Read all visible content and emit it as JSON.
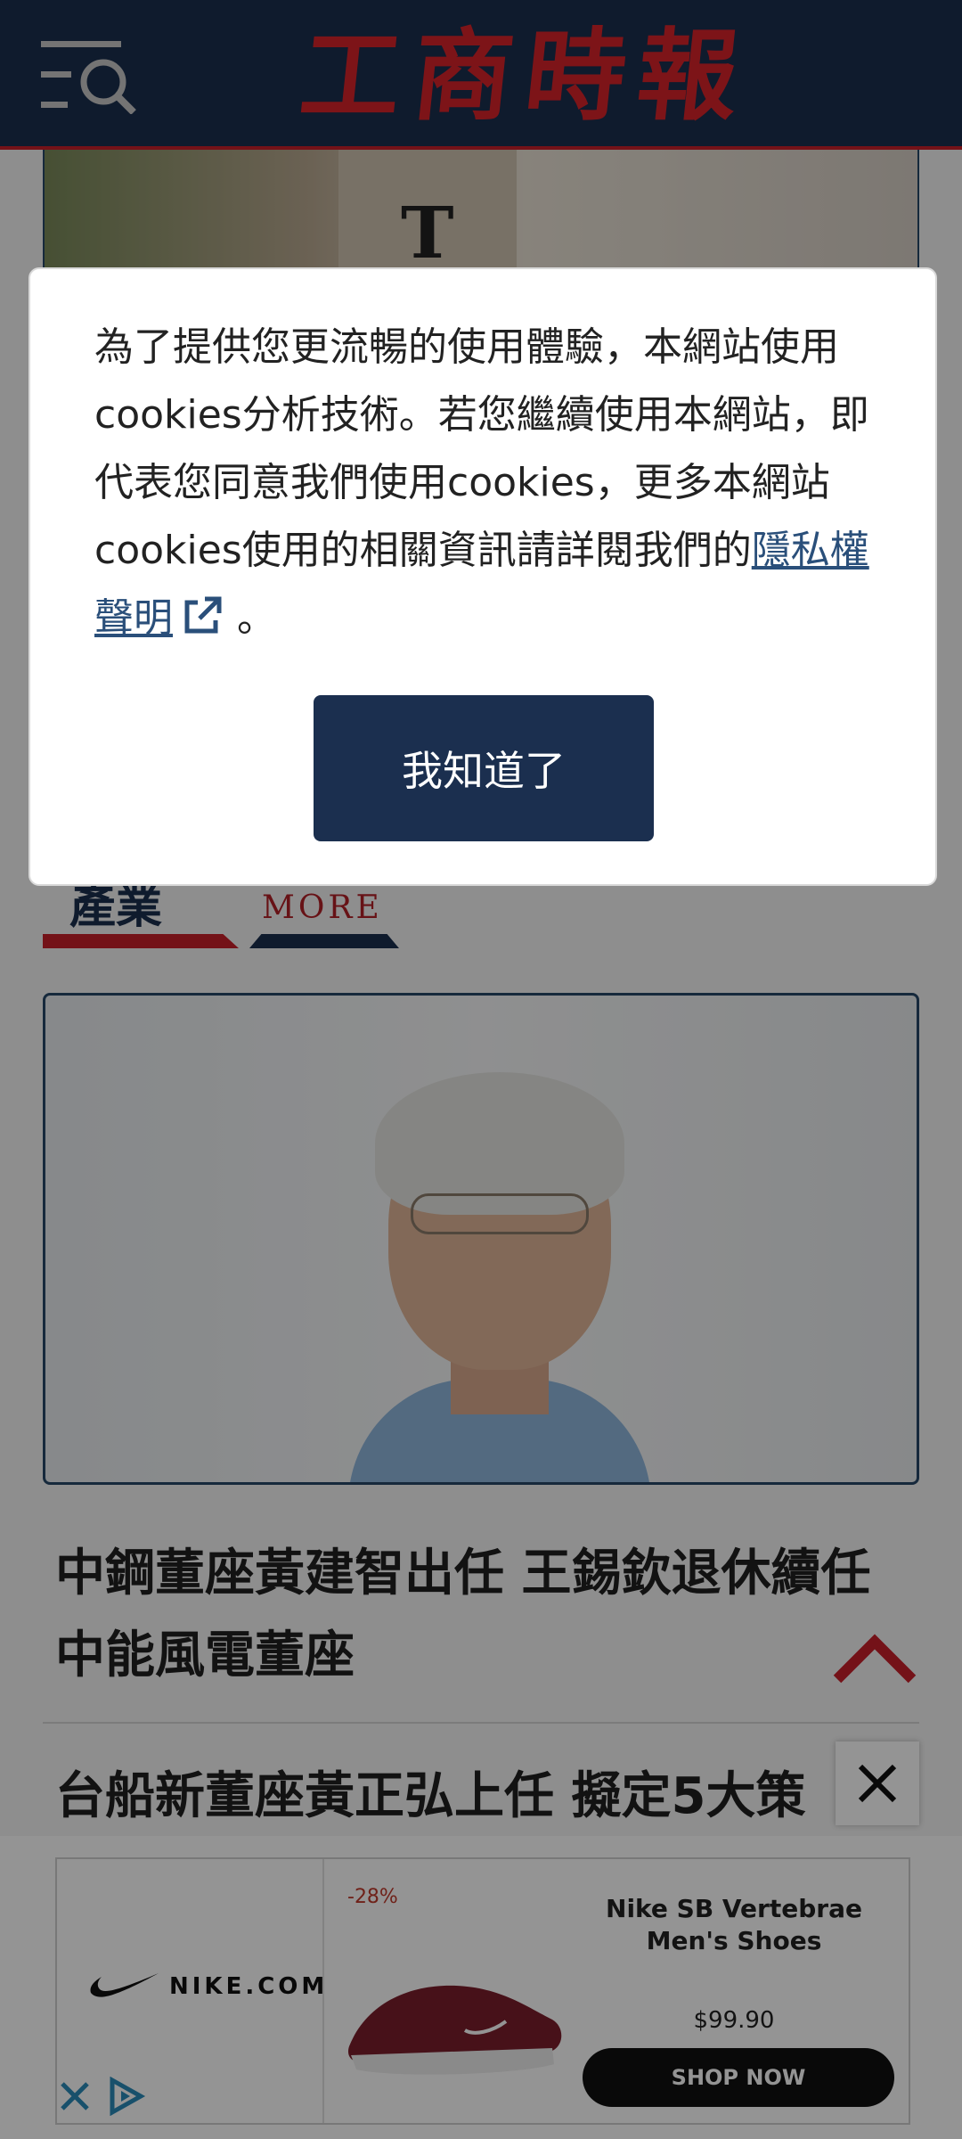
{
  "header": {
    "brand": "工商時報"
  },
  "section": {
    "title": "產業",
    "more_label": "MORE"
  },
  "articles": [
    {
      "headline": "中鋼董座黃建智出任 王錫欽退休續任中能風電董座"
    },
    {
      "headline": "台船新董座黃正弘上任 擬定5大策"
    }
  ],
  "cookie_dialog": {
    "text": "為了提供您更流暢的使用體驗，本網站使用cookies分析技術。若您繼續使用本網站，即代表您同意我們使用cookies，更多本網站cookies使用的相關資訊請詳閱我們的",
    "link_label": "隱私權聲明",
    "tail": "。",
    "button_label": "我知道了"
  },
  "ad": {
    "brand_domain": "NIKE.COM",
    "discount": "-28%",
    "title": "Nike SB Vertebrae Men's Shoes",
    "price": "$99.90",
    "cta": "SHOP NOW"
  },
  "colors": {
    "navy": "#1b2f4f",
    "brand_red": "#d8232a",
    "link": "#2a4f7a"
  },
  "icons": [
    "menu-search-icon",
    "external-link-icon",
    "chevron-up-icon",
    "close-icon",
    "nike-swoosh-icon",
    "adchoices-icon"
  ]
}
